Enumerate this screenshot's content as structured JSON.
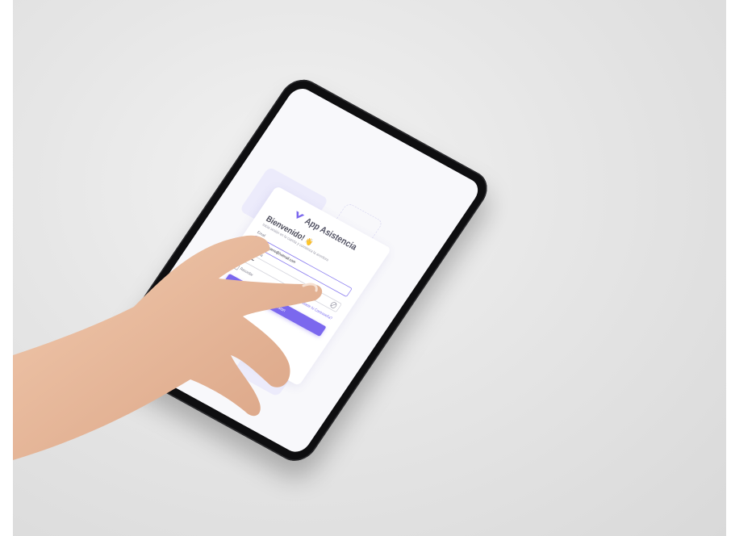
{
  "app": {
    "name": "App Asistencia",
    "accent_color": "#7b68ee"
  },
  "login": {
    "welcome": "Bienvenido!",
    "wave_emoji": "👋",
    "subtitle": "Inicia sesión en tu cuenta y comienza la aventura",
    "email_label": "Email",
    "email_value": "manuelxiqueno@hotmail.com",
    "password_label": "Contraseña",
    "password_value": "••••••••",
    "remember_label": "Recordar",
    "forgot_link": "¿Olvidaste tu Contraseña?",
    "submit_label": "Iniciar Sesion"
  }
}
